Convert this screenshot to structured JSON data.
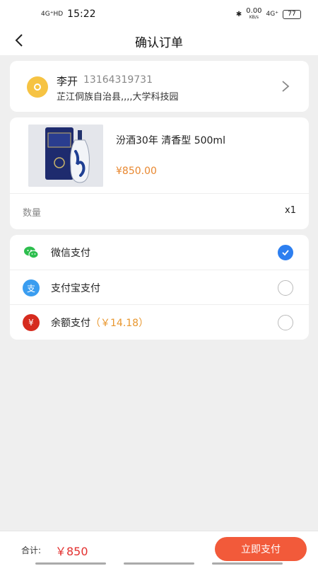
{
  "status_bar": {
    "signal": "4G⁺HD",
    "time": "15:22",
    "right_signal": "4G⁺",
    "net_speed": "0.00",
    "net_unit": "KB/s",
    "battery": "77"
  },
  "header": {
    "title": "确认订单"
  },
  "address": {
    "name": "李开",
    "phone": "13164319731",
    "detail": "芷江侗族自治县,,,,大学科技园"
  },
  "product": {
    "name": "汾酒30年 清香型 500ml",
    "price": "¥850.00",
    "quantity_label": "数量",
    "quantity_value": "x1"
  },
  "payment_methods": [
    {
      "label": "微信支付",
      "extra": "",
      "icon": "wechat-icon",
      "color": "#2dbe4e",
      "selected": true
    },
    {
      "label": "支付宝支付",
      "extra": "",
      "icon": "alipay-icon",
      "color": "#3a9df0",
      "selected": false
    },
    {
      "label": "余额支付",
      "extra": "（￥14.18）",
      "icon": "balance-icon",
      "color": "#d62b1e",
      "selected": false
    }
  ],
  "footer": {
    "total_label": "合计:",
    "total_value": "￥850",
    "pay_button": "立即支付"
  },
  "colors": {
    "accent": "#f25a3a",
    "price": "#e8872f",
    "selected_radio": "#2d7ff0"
  }
}
